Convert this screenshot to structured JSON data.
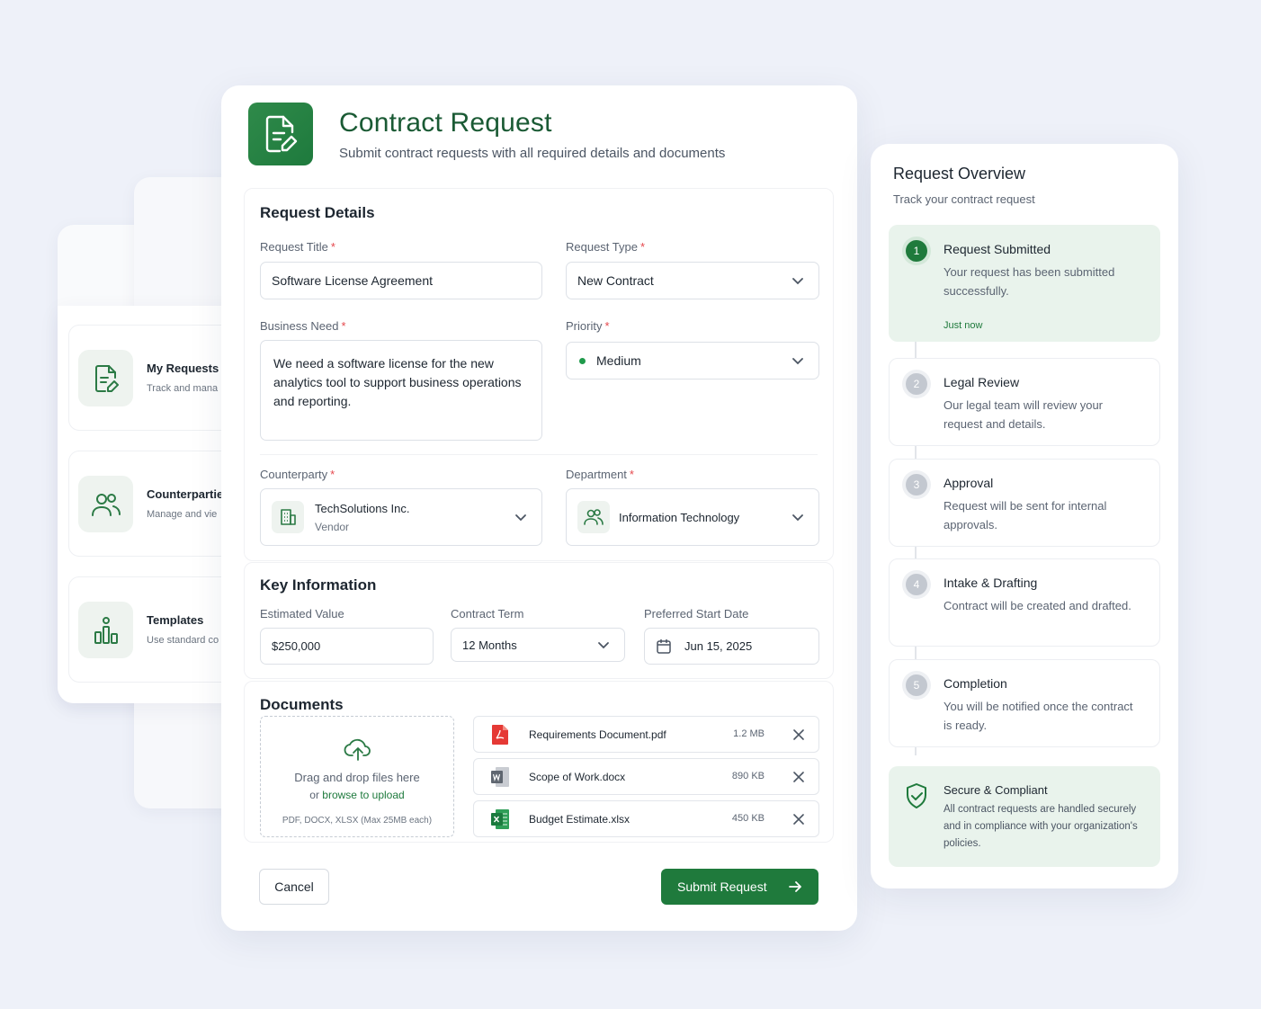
{
  "colors": {
    "brand": "#1f7a3c",
    "required": "#e5484d",
    "background": "#eef1f9"
  },
  "side_nav": {
    "items": [
      {
        "title": "My Requests",
        "subtitle": "Track and mana",
        "icon": "document-edit-icon"
      },
      {
        "title": "Counterpartie",
        "subtitle": "Manage and vie",
        "icon": "users-icon"
      },
      {
        "title": "Templates",
        "subtitle": "Use standard co",
        "icon": "templates-icon"
      }
    ]
  },
  "header": {
    "icon": "document-edit-icon",
    "title": "Contract Request",
    "subtitle": "Submit contract requests with all required details and documents"
  },
  "required_mark": "*",
  "request_details": {
    "title": "Request Details",
    "request_title_label": "Request Title",
    "request_title_value": "Software License Agreement",
    "request_type_label": "Request Type",
    "request_type_value": "New Contract",
    "business_need_label": "Business Need",
    "business_need_value": "We need a software license for the new analytics tool to support business operations and reporting.",
    "priority_label": "Priority",
    "priority_value": "Medium",
    "counterparty_label": "Counterparty",
    "counterparty_name": "TechSolutions Inc.",
    "counterparty_type": "Vendor",
    "department_label": "Department",
    "department_value": "Information Technology"
  },
  "key_information": {
    "title": "Key Information",
    "estimated_value_label": "Estimated Value",
    "estimated_value": "$250,000",
    "contract_term_label": "Contract Term",
    "contract_term_value": "12 Months",
    "start_date_label": "Preferred Start Date",
    "start_date_value": "Jun 15, 2025"
  },
  "documents": {
    "title": "Documents",
    "drop_text": "Drag and drop files here",
    "or_text": "or",
    "browse_text": "browse to upload",
    "hint": "PDF, DOCX, XLSX (Max 25MB each)",
    "files": [
      {
        "name": "Requirements Document.pdf",
        "size": "1.2 MB",
        "icon": "pdf-file-icon"
      },
      {
        "name": "Scope of Work.docx",
        "size": "890 KB",
        "icon": "word-file-icon"
      },
      {
        "name": "Budget Estimate.xlsx",
        "size": "450 KB",
        "icon": "excel-file-icon"
      }
    ]
  },
  "actions": {
    "cancel": "Cancel",
    "submit": "Submit Request"
  },
  "overview": {
    "title": "Request Overview",
    "subtitle": "Track your contract request",
    "steps": [
      {
        "num": "1",
        "title": "Request Submitted",
        "desc": "Your request has been submitted successfully.",
        "time": "Just now",
        "active": true
      },
      {
        "num": "2",
        "title": "Legal Review",
        "desc": "Our legal team will review your request and details."
      },
      {
        "num": "3",
        "title": "Approval",
        "desc": "Request will be sent for internal approvals."
      },
      {
        "num": "4",
        "title": "Intake & Drafting",
        "desc": "Contract will be created and drafted."
      },
      {
        "num": "5",
        "title": "Completion",
        "desc": "You will be notified once the contract is ready."
      }
    ],
    "secure_title": "Secure & Compliant",
    "secure_desc": "All contract requests are handled securely and in compliance with your organization's policies."
  }
}
